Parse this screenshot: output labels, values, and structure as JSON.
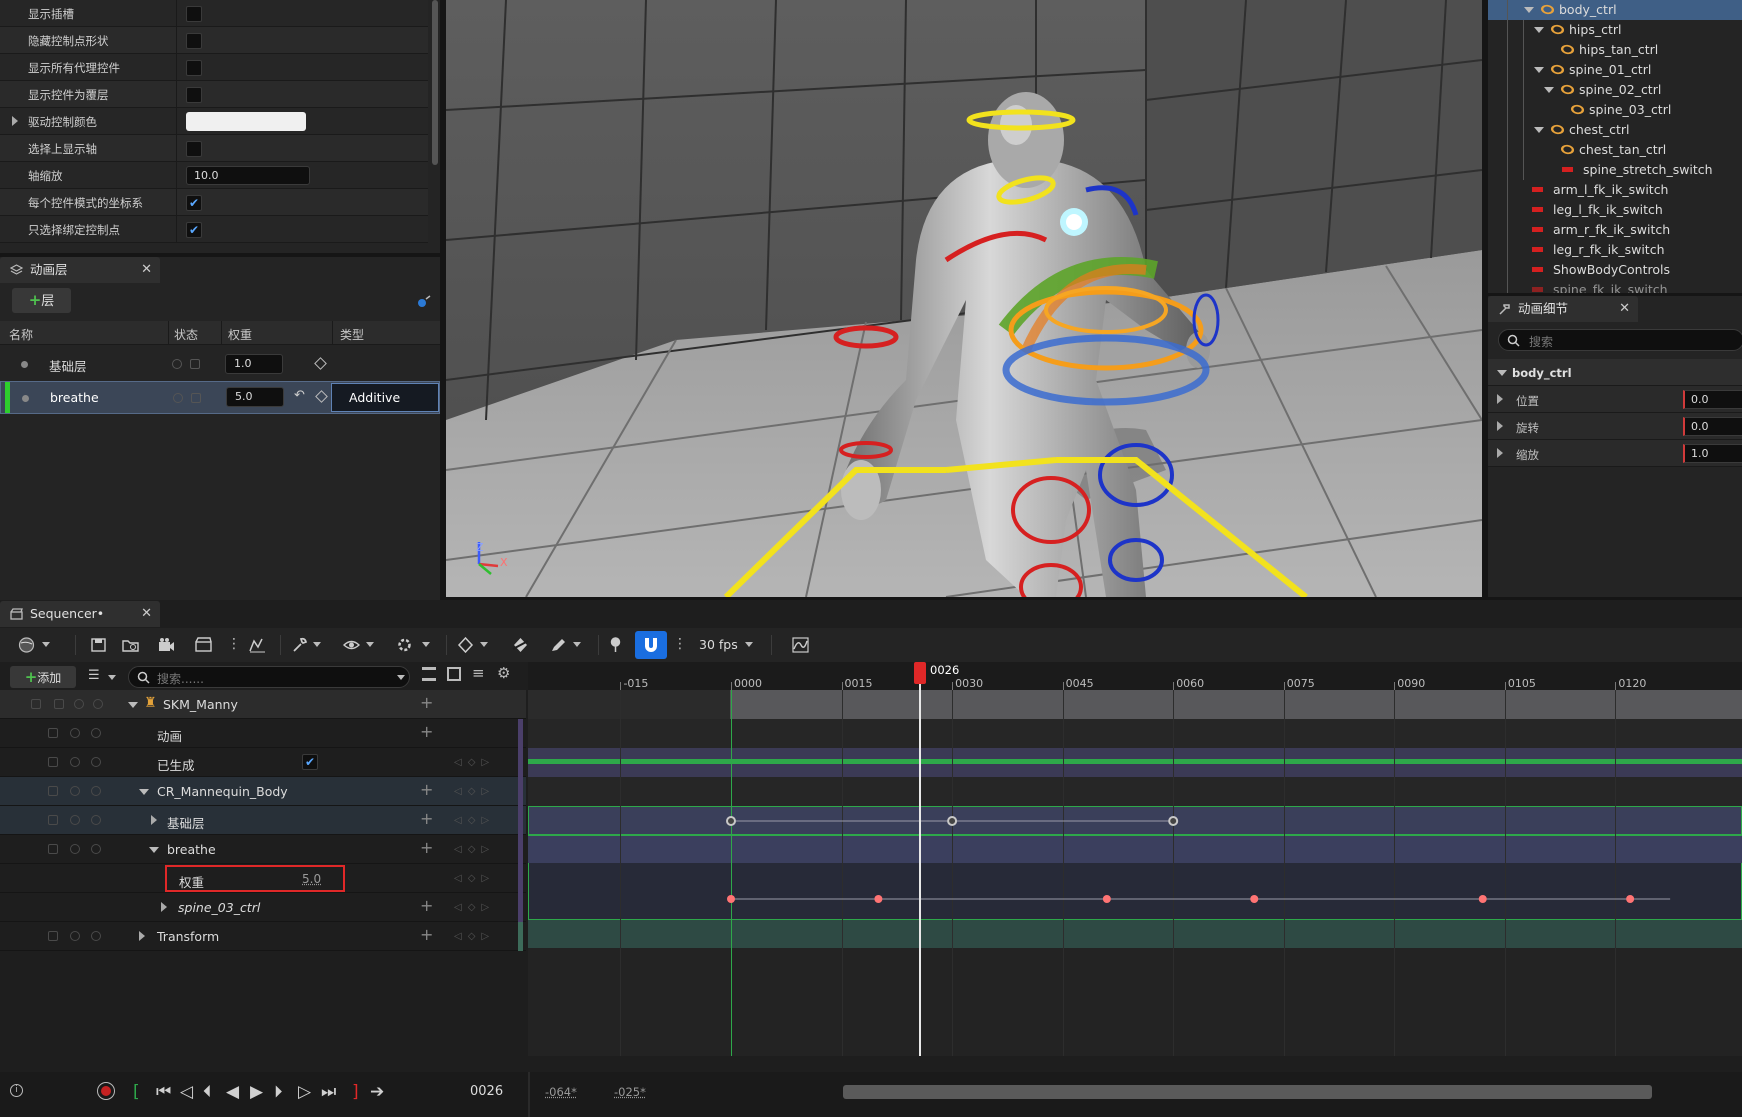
{
  "details_panel": {
    "rows": [
      {
        "label": "显示插槽",
        "type": "checkbox",
        "checked": false
      },
      {
        "label": "隐藏控制点形状",
        "type": "checkbox",
        "checked": false
      },
      {
        "label": "显示所有代理控件",
        "type": "checkbox",
        "checked": false
      },
      {
        "label": "显示控件为覆层",
        "type": "checkbox",
        "checked": false
      },
      {
        "label": "驱动控制颜色",
        "type": "color",
        "color": "#f0f0f0"
      },
      {
        "label": "选择上显示轴",
        "type": "checkbox",
        "checked": false
      },
      {
        "label": "轴缩放",
        "type": "number",
        "value": "10.0"
      },
      {
        "label": "每个控件模式的坐标系",
        "type": "checkbox",
        "checked": true
      },
      {
        "label": "只选择绑定控制点",
        "type": "checkbox",
        "checked": true
      }
    ]
  },
  "anim_layers": {
    "tab_title": "动画层",
    "add_button": "层",
    "columns": {
      "name": "名称",
      "state": "状态",
      "weight": "权重",
      "type": "类型"
    },
    "layers": [
      {
        "name": "基础层",
        "weight": "1.0",
        "type": ""
      },
      {
        "name": "breathe",
        "weight": "5.0",
        "type": "Additive"
      }
    ]
  },
  "viewport": {
    "axis_x": "X",
    "axis_z": "Z"
  },
  "rig_tree": {
    "items": [
      {
        "label": "body_ctrl",
        "kind": "ctrl"
      },
      {
        "label": "hips_ctrl",
        "kind": "ctrl"
      },
      {
        "label": "hips_tan_ctrl",
        "kind": "ctrl"
      },
      {
        "label": "spine_01_ctrl",
        "kind": "ctrl"
      },
      {
        "label": "spine_02_ctrl",
        "kind": "ctrl"
      },
      {
        "label": "spine_03_ctrl",
        "kind": "ctrl"
      },
      {
        "label": "chest_ctrl",
        "kind": "ctrl"
      },
      {
        "label": "chest_tan_ctrl",
        "kind": "ctrl"
      },
      {
        "label": "spine_stretch_switch",
        "kind": "switch"
      },
      {
        "label": "arm_l_fk_ik_switch",
        "kind": "switch"
      },
      {
        "label": "leg_l_fk_ik_switch",
        "kind": "switch"
      },
      {
        "label": "arm_r_fk_ik_switch",
        "kind": "switch"
      },
      {
        "label": "leg_r_fk_ik_switch",
        "kind": "switch"
      },
      {
        "label": "ShowBodyControls",
        "kind": "switch"
      },
      {
        "label": "spine_fk_ik_switch",
        "kind": "switch"
      }
    ]
  },
  "anim_details": {
    "tab_title": "动画细节",
    "search_placeholder": "搜索",
    "section": "body_ctrl",
    "props": [
      {
        "label": "位置",
        "value": "0.0"
      },
      {
        "label": "旋转",
        "value": "0.0"
      },
      {
        "label": "缩放",
        "value": "1.0"
      }
    ]
  },
  "sequencer": {
    "tab_title": "Sequencer•",
    "fps": "30 fps",
    "add_button": "添加",
    "search_placeholder": "搜索......",
    "current_frame": "0026",
    "playhead_label": "0026",
    "view_start": "-064*",
    "view_end": "-025*",
    "ticks": [
      "-015",
      "0000",
      "0015",
      "0030",
      "0045",
      "0060",
      "0075",
      "0090",
      "0105",
      "0120"
    ],
    "tracks": [
      {
        "label": "SKM_Manny"
      },
      {
        "label": "动画"
      },
      {
        "label": "已生成"
      },
      {
        "label": "CR_Mannequin_Body"
      },
      {
        "label": "基础层"
      },
      {
        "label": "breathe"
      },
      {
        "label": "权重",
        "value": "5.0"
      },
      {
        "label": "spine_03_ctrl"
      },
      {
        "label": "Transform"
      }
    ],
    "keys_baselayer": [
      0,
      30,
      60
    ],
    "keys_spine03": [
      0,
      20,
      51,
      71,
      102,
      122
    ]
  },
  "colors": {
    "accent": "#1a6ee0",
    "playhead": "#e02828",
    "selection": "#3f4b5c"
  }
}
